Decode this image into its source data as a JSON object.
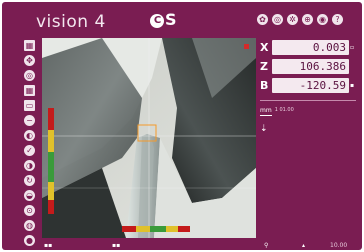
{
  "header": {
    "title": "vision 4",
    "logo_text": "S",
    "logo_mark": "C",
    "icons": [
      "gear-icon",
      "target-icon",
      "settings-icon",
      "zoom-icon",
      "info-icon",
      "help-icon"
    ]
  },
  "toolbar": {
    "tools": [
      "grid-icon",
      "crosshair-icon",
      "target-icon",
      "grid-small-icon",
      "frame-icon",
      "minus-icon",
      "brightness-icon",
      "check-icon",
      "contrast-icon",
      "cycle-icon",
      "drop-icon",
      "focus-icon",
      "lens-icon",
      "record-icon",
      "light-icon"
    ]
  },
  "readout": {
    "x": {
      "label": "X",
      "value": "0.003"
    },
    "z": {
      "label": "Z",
      "value": "106.386"
    },
    "b": {
      "label": "B",
      "value": "-120.59"
    },
    "mm_label": "mm",
    "mm_sub": "1\n01.00"
  },
  "colors": {
    "frame": "#7a1d52",
    "readout_bg": "#f4e9ef",
    "scale_red": "#c41b1b",
    "scale_yellow": "#e0c12b",
    "scale_green": "#3a9b3a"
  },
  "bottom": {
    "left_icon": "grid-icon",
    "mid_icon": "grid-icon",
    "right_icons": [
      "person-icon",
      "cursor-icon"
    ],
    "right_label": "10.00"
  }
}
